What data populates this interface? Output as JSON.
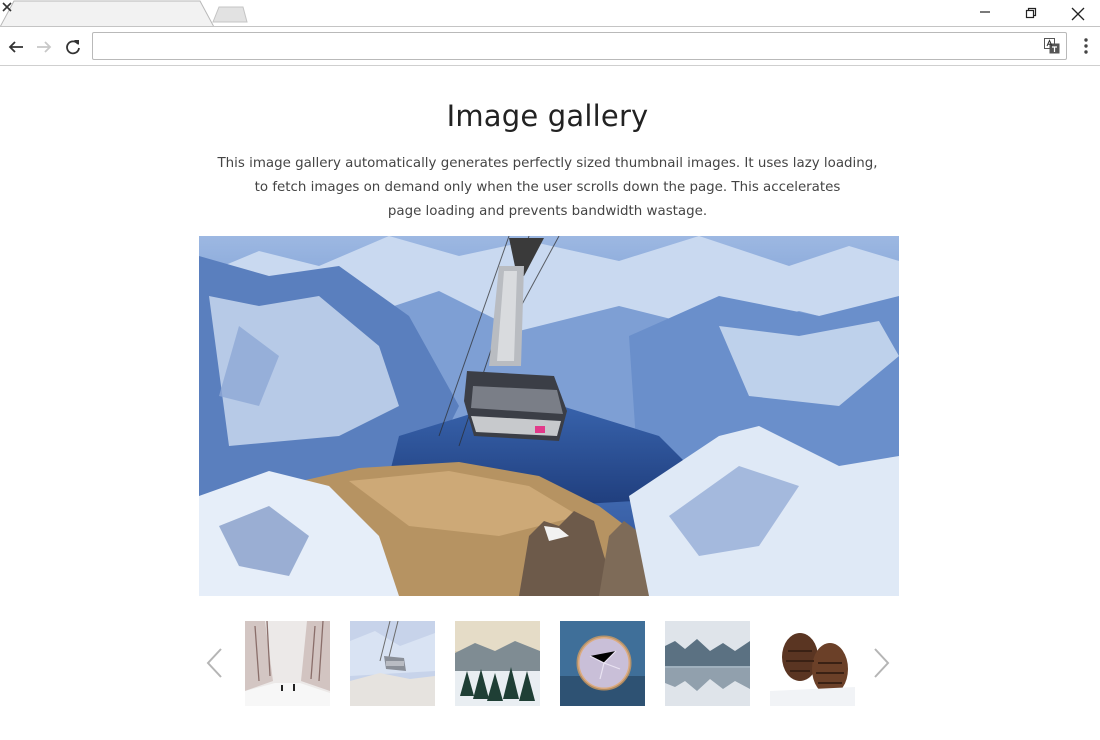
{
  "browser": {
    "tab_title": "",
    "address_value": "",
    "address_placeholder": "",
    "icons": [
      "tab-close-icon",
      "new-tab-icon",
      "minimize-icon",
      "restore-icon",
      "window-close-icon",
      "back-arrow-icon",
      "forward-arrow-icon",
      "reload-icon",
      "translate-icon",
      "kebab-menu-icon"
    ]
  },
  "gallery": {
    "title": "Image gallery",
    "description_lines": [
      "This image gallery automatically generates perfectly sized thumbnail images. It uses lazy loading,",
      "to fetch images on demand only when the user scrolls down the page. This accelerates",
      "page loading and prevents bandwidth wastage."
    ],
    "main_image": "cable-car-over-snowy-mountains",
    "thumbnails": [
      "snowy-tree-lined-path",
      "cable-car-mountains",
      "snowy-pine-forest",
      "frozen-bubble",
      "misty-lake-reflection",
      "pine-cones-in-snow"
    ],
    "prev_icon": "chevron-left-icon",
    "next_icon": "chevron-right-icon"
  },
  "colors": {
    "title_text": "#222222",
    "description_text": "#444444",
    "arrow": "#b5b5b5"
  }
}
